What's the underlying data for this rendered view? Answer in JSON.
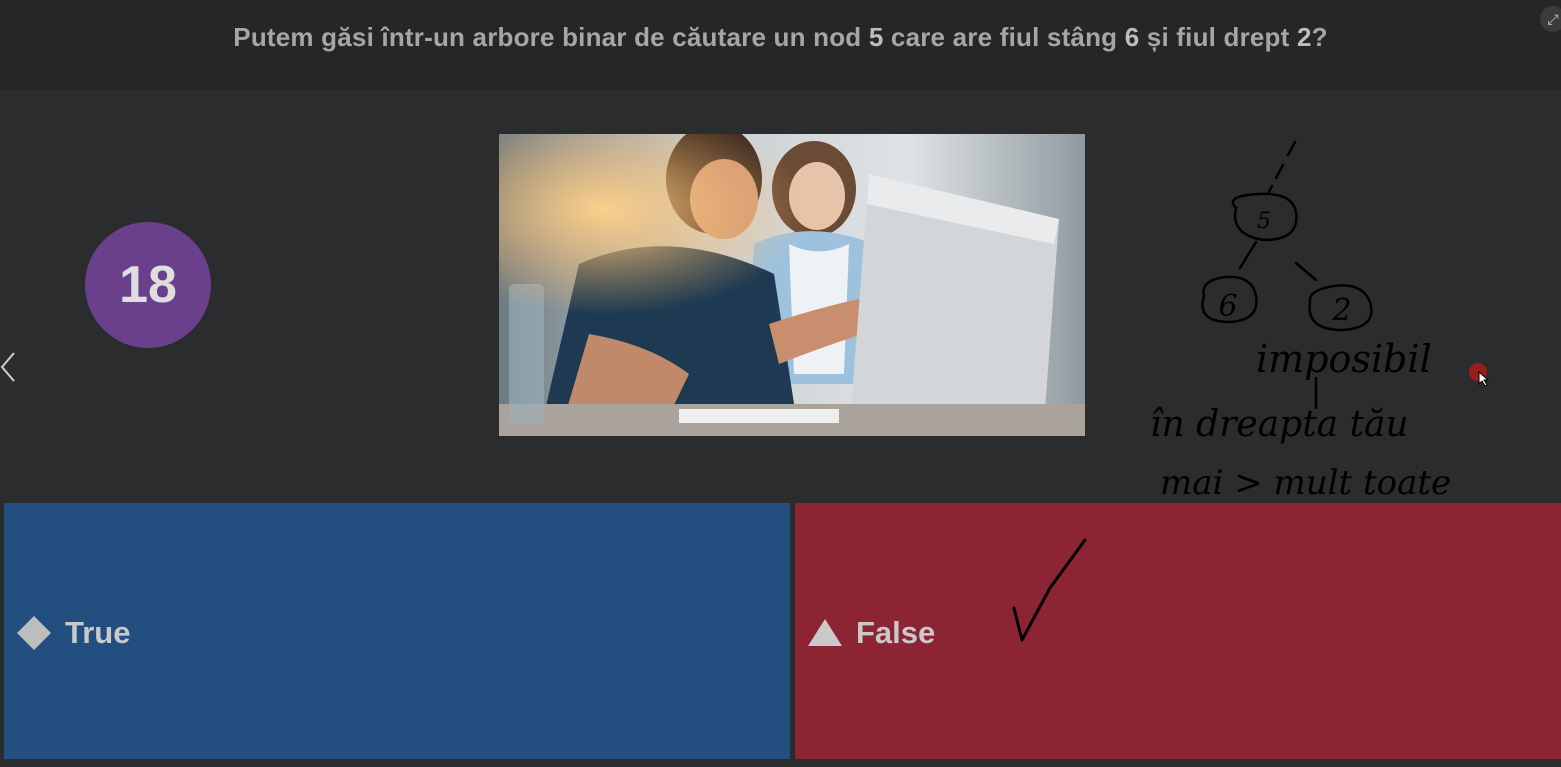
{
  "question": {
    "part1": "Putem găsi într-un arbore binar de căutare un nod ",
    "num1": "5",
    "part2": " care are fiul stâng ",
    "num2": "6",
    "part3": " și fiul drept ",
    "num3": "2",
    "part4": "?"
  },
  "question_number": "18",
  "answers": [
    {
      "label": "True",
      "icon": "diamond-icon",
      "color": "#234e80"
    },
    {
      "label": "False",
      "icon": "triangle-icon",
      "color": "#8c2434"
    }
  ],
  "colors": {
    "background": "#2b2c2e",
    "header": "#252627",
    "accent_purple": "#6a3f8c"
  },
  "handwriting": {
    "node_root": "5",
    "node_left": "6",
    "node_right": "2",
    "line1": "imposibil",
    "line2": "în dreapta tău",
    "line3": "mai > mult toate"
  }
}
